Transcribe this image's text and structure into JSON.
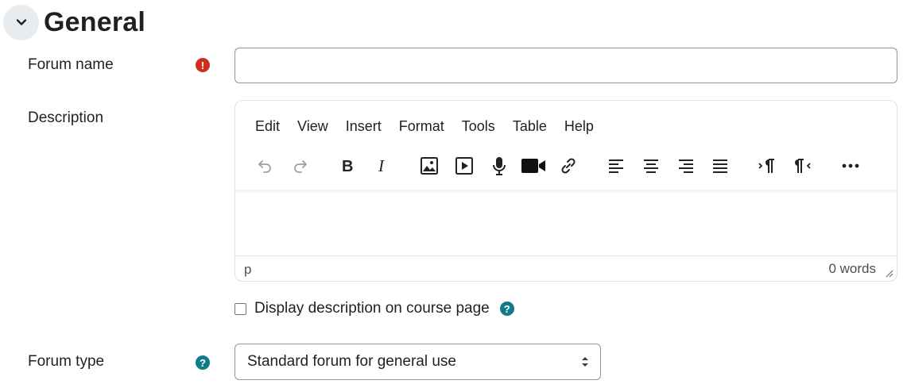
{
  "section": {
    "title": "General",
    "toggle_icon": "chevron-down-icon"
  },
  "forum_name": {
    "label": "Forum name",
    "value": "",
    "required_icon": "exclamation-circle-icon",
    "required_color": "#ca3120"
  },
  "description": {
    "label": "Description",
    "menu": [
      "Edit",
      "View",
      "Insert",
      "Format",
      "Tools",
      "Table",
      "Help"
    ],
    "toolbar_icons": [
      "undo-icon",
      "redo-icon",
      "bold-icon",
      "italic-icon",
      "image-icon",
      "media-icon",
      "microphone-icon",
      "video-camera-icon",
      "link-icon",
      "align-left-icon",
      "align-center-icon",
      "align-right-icon",
      "align-justify-icon",
      "ltr-icon",
      "rtl-icon",
      "more-icon"
    ],
    "status_path": "p",
    "word_count": "0 words"
  },
  "display_description": {
    "label": "Display description on course page",
    "checked": false,
    "help_icon": "question-circle-icon"
  },
  "forum_type": {
    "label": "Forum type",
    "selected": "Standard forum for general use",
    "help_icon": "question-circle-icon"
  },
  "colors": {
    "help": "#0f7c8a",
    "required": "#ca3120",
    "text": "#1d2125"
  }
}
